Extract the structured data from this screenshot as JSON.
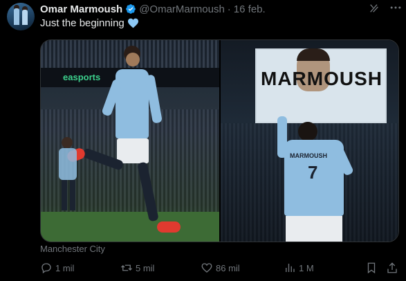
{
  "tweet": {
    "author_name": "Omar Marmoush",
    "handle": "@OmarMarmoush",
    "separator": "·",
    "date": "16 feb.",
    "text": "Just the beginning",
    "text_emoji": "blue-heart-icon",
    "media_caption": "Manchester City"
  },
  "media": {
    "left_photo": {
      "board_text": "easports"
    },
    "right_photo": {
      "screen_text": "MARMOUSH",
      "jersey_name": "MARMOUSH",
      "jersey_number": "7"
    }
  },
  "actions": {
    "replies": "1 mil",
    "reposts": "5 mil",
    "likes": "86 mil",
    "views": "1 M"
  },
  "colors": {
    "background": "#000000",
    "text_primary": "#e7e9ea",
    "text_secondary": "#71767b",
    "verified_blue": "#1d9bf0",
    "heart_blue": "#8cc8f5"
  }
}
